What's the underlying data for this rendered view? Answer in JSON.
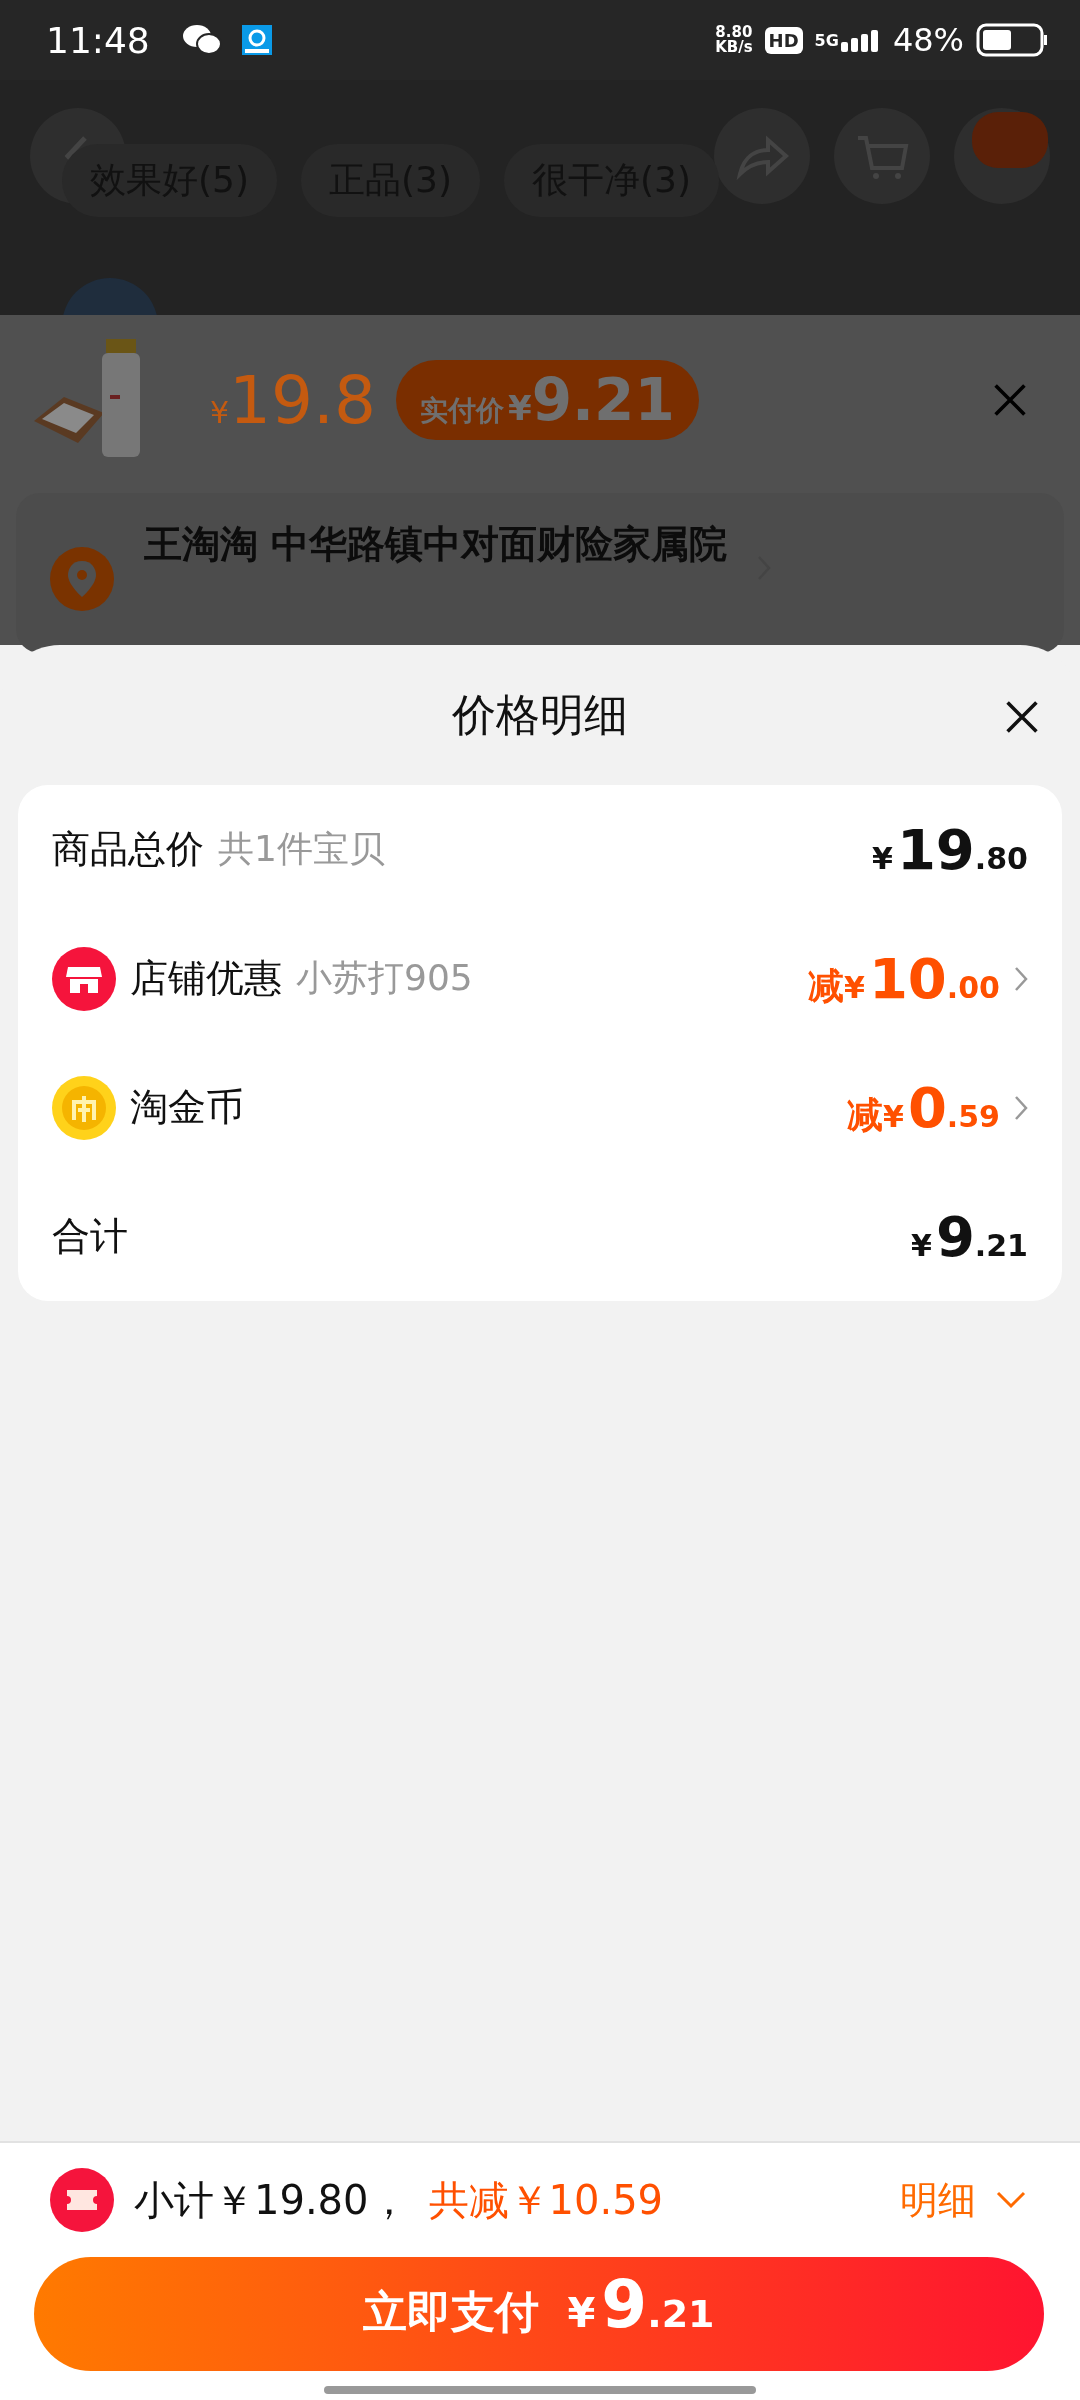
{
  "status_bar": {
    "time": "11:48",
    "speed_value": "8.80",
    "speed_unit": "KB/s",
    "hd": "HD",
    "network": "5G",
    "battery": "48%"
  },
  "background_page": {
    "tags": [
      "效果好(5)",
      "正品(3)",
      "很干净(3)"
    ]
  },
  "sku_panel": {
    "price": {
      "currency": "¥",
      "value": "19.8"
    },
    "badge": {
      "label": "实付价",
      "currency": "¥",
      "value": "9.21"
    },
    "address": "王淘淘 中华路镇中对面财险家属院"
  },
  "sheet": {
    "title": "价格明细",
    "rows": [
      {
        "kind": "plain",
        "label": "商品总价",
        "note": "共1件宝贝",
        "amount": {
          "currency": "¥",
          "integer": "19",
          "decimal": ".80"
        },
        "discount": false
      },
      {
        "kind": "shop",
        "label": "店铺优惠",
        "note": "小苏打905",
        "amount": {
          "prefix": "减",
          "currency": "¥",
          "integer": "10",
          "decimal": ".00"
        },
        "discount": true
      },
      {
        "kind": "coin",
        "label": "淘金币",
        "amount": {
          "prefix": "减",
          "currency": "¥",
          "integer": "0",
          "decimal": ".59"
        },
        "discount": true
      },
      {
        "kind": "plain",
        "label": "合计",
        "amount": {
          "currency": "¥",
          "integer": "9",
          "decimal": ".21"
        },
        "discount": false
      }
    ]
  },
  "footer": {
    "subtotal": "小计￥19.80，",
    "total_discount": "共减￥10.59",
    "details": "明细",
    "pay_button": {
      "label": "立即支付",
      "currency": "¥",
      "integer": "9",
      "decimal": ".21"
    }
  }
}
